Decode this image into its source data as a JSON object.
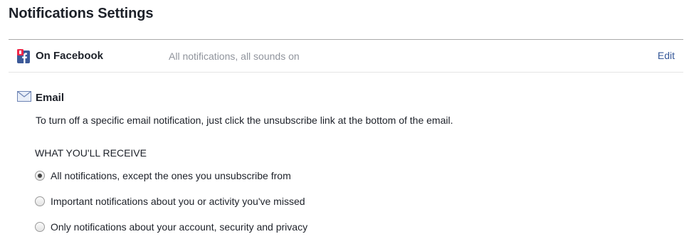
{
  "page": {
    "title": "Notifications Settings"
  },
  "on_facebook": {
    "label": "On Facebook",
    "summary": "All notifications, all sounds on",
    "edit_label": "Edit",
    "icon": "facebook-icon"
  },
  "email": {
    "label": "Email",
    "icon": "envelope-icon",
    "description": "To turn off a specific email notification, just click the unsubscribe link at the bottom of the email.",
    "receive_heading": "WHAT YOU'LL RECEIVE",
    "options": [
      {
        "label": "All notifications, except the ones you unsubscribe from",
        "selected": true
      },
      {
        "label": "Important notifications about you or activity you've missed",
        "selected": false
      },
      {
        "label": "Only notifications about your account, security and privacy",
        "selected": false
      }
    ]
  },
  "colors": {
    "text": "#1d2129",
    "muted": "#90949c",
    "link": "#365899",
    "facebook_blue": "#3b5998"
  }
}
